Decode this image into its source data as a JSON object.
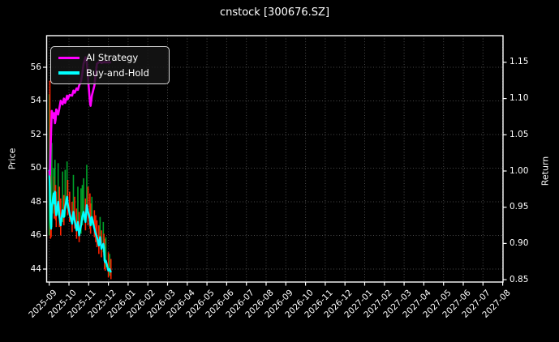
{
  "title": "cnstock [300676.SZ]",
  "legend": {
    "items": [
      {
        "label": "AI Strategy",
        "color": "#ff00ff"
      },
      {
        "label": "Buy-and-Hold",
        "color": "#00ffff"
      }
    ]
  },
  "axes": {
    "left": {
      "label": "Price",
      "ticks": [
        "44",
        "46",
        "48",
        "50",
        "52",
        "54",
        "56"
      ]
    },
    "right": {
      "label": "Return",
      "ticks": [
        "0.85",
        "0.90",
        "0.95",
        "1.00",
        "1.05",
        "1.10",
        "1.15"
      ]
    },
    "x": {
      "ticks": [
        "2025-09",
        "2025-10",
        "2025-11",
        "2025-12",
        "2026-01",
        "2026-02",
        "2026-03",
        "2026-04",
        "2026-05",
        "2026-06",
        "2026-07",
        "2026-08",
        "2026-09",
        "2026-10",
        "2026-11",
        "2026-12",
        "2027-01",
        "2027-02",
        "2027-03",
        "2027-04",
        "2027-05",
        "2027-06",
        "2027-07",
        "2027-08"
      ]
    }
  },
  "colors": {
    "background": "#000000",
    "plot_border": "#ffffff",
    "grid": "#4a4a4a",
    "text": "#ffffff",
    "ai_strategy": "#ff00ff",
    "buy_and_hold": "#00ffff",
    "bar_up": "#00a32a",
    "bar_down": "#ff2200"
  },
  "chart_data": {
    "type": "line",
    "title": "cnstock [300676.SZ]",
    "xlabel": "",
    "left_ylabel": "Price",
    "right_ylabel": "Return",
    "left_ylim": [
      43.2,
      57.9
    ],
    "right_ylim": [
      0.847,
      1.187
    ],
    "x_range_shown": [
      "2025-09",
      "2027-08"
    ],
    "data_ends": "2025-12-05",
    "grid": true,
    "legend_position": "upper left",
    "x_dates": [
      "2025-09-01",
      "2025-09-02",
      "2025-09-03",
      "2025-09-04",
      "2025-09-05",
      "2025-09-08",
      "2025-09-09",
      "2025-09-10",
      "2025-09-11",
      "2025-09-12",
      "2025-09-15",
      "2025-09-17",
      "2025-09-19",
      "2025-09-22",
      "2025-09-24",
      "2025-09-26",
      "2025-09-29",
      "2025-09-30",
      "2025-10-02",
      "2025-10-06",
      "2025-10-08",
      "2025-10-10",
      "2025-10-13",
      "2025-10-15",
      "2025-10-17",
      "2025-10-20",
      "2025-10-22",
      "2025-10-24",
      "2025-10-27",
      "2025-10-29",
      "2025-10-31",
      "2025-11-03",
      "2025-11-04",
      "2025-11-06",
      "2025-11-10",
      "2025-11-12",
      "2025-11-14",
      "2025-11-17",
      "2025-11-19",
      "2025-11-21",
      "2025-11-24",
      "2025-11-25",
      "2025-11-26",
      "2025-11-27",
      "2025-11-28",
      "2025-12-01",
      "2025-12-03",
      "2025-12-05"
    ],
    "series": [
      {
        "name": "AI Strategy",
        "axis": "return",
        "color": "#ff00ff",
        "values": [
          1.0,
          0.995,
          1.027,
          1.057,
          1.083,
          1.073,
          1.08,
          1.066,
          1.071,
          1.085,
          1.078,
          1.087,
          1.097,
          1.092,
          1.1,
          1.094,
          1.104,
          1.099,
          1.105,
          1.104,
          1.111,
          1.108,
          1.114,
          1.112,
          1.118,
          1.124,
          1.135,
          1.148,
          1.157,
          1.15,
          1.128,
          1.095,
          1.09,
          1.104,
          1.118,
          1.134,
          1.148,
          1.15,
          1.151,
          1.149,
          1.15,
          1.15,
          1.151,
          1.15,
          1.15,
          1.15,
          1.15,
          1.15
        ]
      },
      {
        "name": "Buy-and-Hold",
        "axis": "price",
        "color": "#00ffff",
        "values": [
          49.9,
          48.8,
          47.0,
          46.4,
          47.7,
          48.5,
          47.9,
          48.6,
          47.6,
          47.2,
          48.0,
          47.1,
          46.6,
          47.5,
          47.1,
          47.7,
          48.3,
          47.9,
          47.3,
          46.7,
          47.4,
          46.9,
          46.3,
          46.8,
          46.0,
          46.6,
          47.1,
          47.4,
          46.8,
          47.8,
          47.4,
          47.0,
          46.6,
          47.1,
          46.4,
          46.1,
          45.9,
          45.4,
          45.9,
          45.2,
          45.5,
          45.3,
          44.5,
          44.4,
          44.5,
          43.9,
          44.0,
          43.8
        ]
      }
    ],
    "price_bars": {
      "up_color": "#00a32a",
      "down_color": "#ff2200",
      "low": [
        46.0,
        47.8,
        45.8,
        45.9,
        46.5,
        47.3,
        47.0,
        47.8,
        46.9,
        46.5,
        47.2,
        46.5,
        46.0,
        46.8,
        46.6,
        47.1,
        47.6,
        47.2,
        46.8,
        46.2,
        46.9,
        46.4,
        45.8,
        46.3,
        45.6,
        46.1,
        46.6,
        46.9,
        46.3,
        47.2,
        46.6,
        46.4,
        46.1,
        46.6,
        45.9,
        45.6,
        45.3,
        44.9,
        45.4,
        44.7,
        45.0,
        44.8,
        44.0,
        43.9,
        44.1,
        43.5,
        43.6,
        43.4
      ],
      "high": [
        54.4,
        55.2,
        52.5,
        50.2,
        51.5,
        50.0,
        49.5,
        50.5,
        49.0,
        48.6,
        50.3,
        48.9,
        48.2,
        49.8,
        48.4,
        49.9,
        50.4,
        49.3,
        48.6,
        48.0,
        49.6,
        48.3,
        47.6,
        48.9,
        47.4,
        48.8,
        49.0,
        49.4,
        48.2,
        50.2,
        48.9,
        48.5,
        47.9,
        48.3,
        47.5,
        47.2,
        46.9,
        46.6,
        47.1,
        46.3,
        46.8,
        46.1,
        45.8,
        45.3,
        45.9,
        45.0,
        44.9,
        44.6
      ],
      "dir": [
        "g",
        "r",
        "r",
        "r",
        "g",
        "g",
        "r",
        "g",
        "r",
        "r",
        "g",
        "r",
        "r",
        "g",
        "r",
        "g",
        "g",
        "r",
        "r",
        "r",
        "g",
        "r",
        "r",
        "g",
        "r",
        "g",
        "g",
        "g",
        "r",
        "g",
        "r",
        "r",
        "r",
        "g",
        "r",
        "r",
        "r",
        "r",
        "g",
        "r",
        "g",
        "r",
        "r",
        "r",
        "g",
        "r",
        "g",
        "r"
      ]
    }
  }
}
